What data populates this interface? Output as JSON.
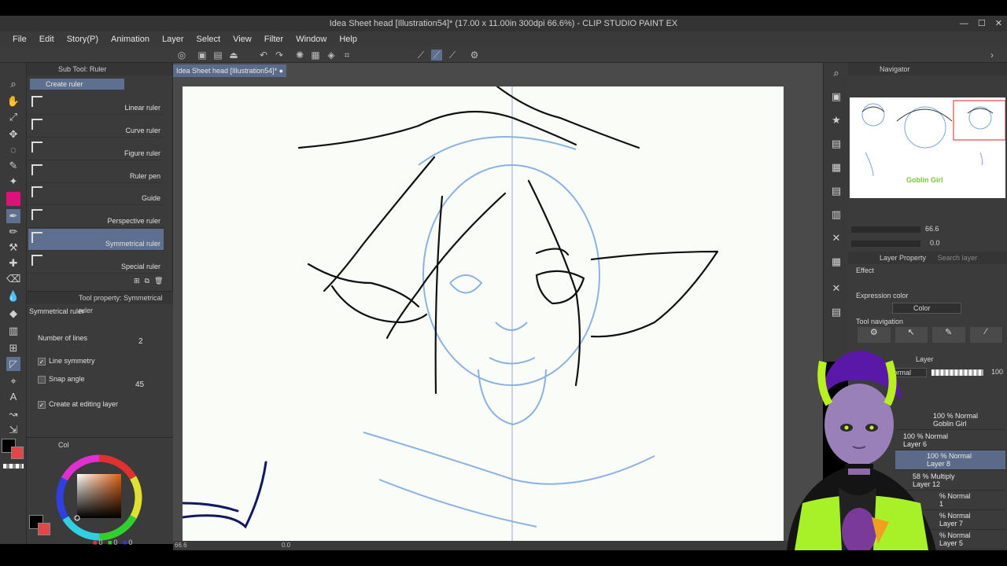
{
  "window": {
    "title": "Idea Sheet head [Illustration54]* (17.00 x 11.00in 300dpi 66.6%) - CLIP STUDIO PAINT EX"
  },
  "menu": [
    "File",
    "Edit",
    "Story(P)",
    "Animation",
    "Layer",
    "Select",
    "View",
    "Filter",
    "Window",
    "Help"
  ],
  "subtool": {
    "header": "Sub Tool: Ruler",
    "group": "Create ruler",
    "items": [
      {
        "label": "Linear ruler",
        "selected": false
      },
      {
        "label": "Curve ruler",
        "selected": false
      },
      {
        "label": "Figure ruler",
        "selected": false
      },
      {
        "label": "Ruler pen",
        "selected": false
      },
      {
        "label": "Guide",
        "selected": false
      },
      {
        "label": "Perspective ruler",
        "selected": false
      },
      {
        "label": "Symmetrical ruler",
        "selected": true
      },
      {
        "label": "Special ruler",
        "selected": false
      }
    ]
  },
  "toolprop": {
    "header": "Tool property: Symmetrical ruler",
    "name": "Symmetrical ruler",
    "number_of_lines_label": "Number of lines",
    "number_of_lines": "2",
    "line_symmetry": "Line symmetry",
    "snap_angle": "Snap angle",
    "snap_angle_value": "45",
    "create_at_editing_layer": "Create at editing layer"
  },
  "color": {
    "tab_label": "Col",
    "main_color": "#e0107a",
    "rgb_values": [
      "0",
      "0",
      "0"
    ]
  },
  "document": {
    "tab_label": "Idea Sheet head [Illustration54]*",
    "zoom": "66.6",
    "angle": "0.0"
  },
  "navigator": {
    "header": "Navigator",
    "zoom": "66.6",
    "angle": "0.0",
    "thumb_caption": "Goblin Girl"
  },
  "layerprop": {
    "header": "Layer Property",
    "search_placeholder": "Search layer",
    "effect_label": "Effect",
    "expression_color_label": "Expression color",
    "expression_color_value": "Color",
    "tool_navigation_label": "Tool navigation"
  },
  "layers": {
    "header": "Layer",
    "blend_mode": "Normal",
    "opacity": "100",
    "rows": [
      {
        "line1": "100 % Normal",
        "line2": "Goblin Girl",
        "selected": false
      },
      {
        "line1": "100 % Normal",
        "line2": "Layer 6",
        "selected": false
      },
      {
        "line1": "100 % Normal",
        "line2": "Layer 8",
        "selected": true
      },
      {
        "line1": "58 % Multiply",
        "line2": "Layer 12",
        "selected": false
      },
      {
        "line1": "% Normal",
        "line2": "1",
        "selected": false
      },
      {
        "line1": "% Normal",
        "line2": "Layer 7",
        "selected": false
      },
      {
        "line1": "% Normal",
        "line2": "Layer 5",
        "selected": false
      }
    ]
  },
  "colors": {
    "accent_blue": "#5f6f8f",
    "sketch_blue": "#7aa6dc",
    "line_black": "#111111",
    "ink_navy": "#141860"
  }
}
